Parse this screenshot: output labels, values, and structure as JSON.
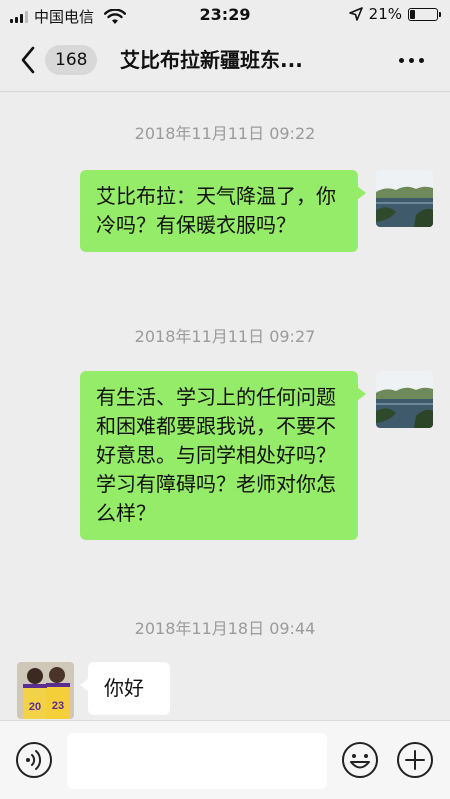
{
  "status_bar": {
    "carrier": "中国电信",
    "time": "23:29",
    "battery": "21%",
    "battery_level": 0.21
  },
  "header": {
    "unread_count": "168",
    "title": "艾比布拉新疆班东..."
  },
  "messages": [
    {
      "timestamp": "2018年11月11日 09:22",
      "direction": "outgoing",
      "text": "艾比布拉：天气降温了，你冷吗？有保暖衣服吗？"
    },
    {
      "timestamp": "2018年11月11日 09:27",
      "direction": "outgoing",
      "text": "有生活、学习上的任何问题和困难都要跟我说，不要不好意思。与同学相处好吗？学习有障碍吗？老师对你怎么样？"
    },
    {
      "timestamp": "2018年11月18日 09:44",
      "direction": "incoming",
      "text": "你好"
    }
  ],
  "avatar_numbers": {
    "left": "20",
    "right": "23"
  },
  "colors": {
    "background": "#ededed",
    "outgoing_bubble": "#95ec69",
    "incoming_bubble": "#ffffff",
    "timestamp": "#9b9b9b"
  },
  "icons": {
    "back": "chevron-left-icon",
    "more": "more-dots-icon",
    "voice": "voice-icon",
    "emoji": "emoji-icon",
    "add": "plus-circle-icon"
  }
}
